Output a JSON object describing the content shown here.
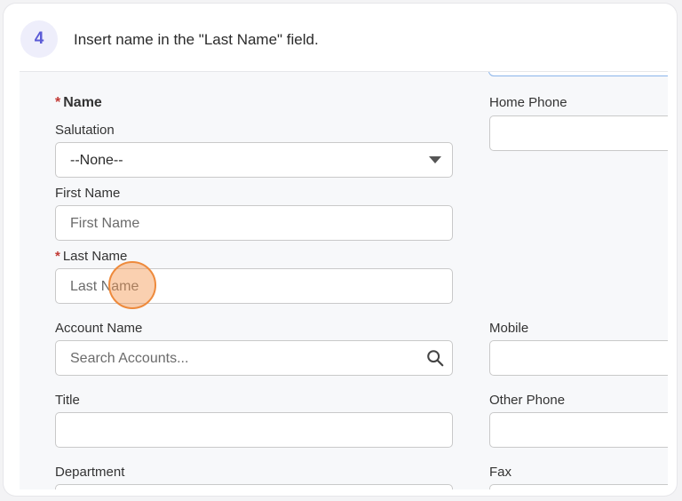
{
  "step": {
    "number": "4",
    "instruction": "Insert name in the \"Last Name\" field."
  },
  "form": {
    "name_section": {
      "label": "Name",
      "required_mark": "*"
    },
    "salutation": {
      "label": "Salutation",
      "value": "--None--"
    },
    "first_name": {
      "label": "First Name",
      "placeholder": "First Name"
    },
    "last_name": {
      "label": "Last Name",
      "required_mark": "*",
      "placeholder": "Last Name"
    },
    "account_name": {
      "label": "Account Name",
      "placeholder": "Search Accounts..."
    },
    "title": {
      "label": "Title"
    },
    "department": {
      "label": "Department"
    },
    "home_phone": {
      "label": "Home Phone"
    },
    "mobile": {
      "label": "Mobile"
    },
    "other_phone": {
      "label": "Other Phone"
    },
    "fax": {
      "label": "Fax"
    }
  },
  "colors": {
    "accent": "#5b5bd6",
    "required": "#c23934",
    "click_marker": "#ee8a3c"
  }
}
